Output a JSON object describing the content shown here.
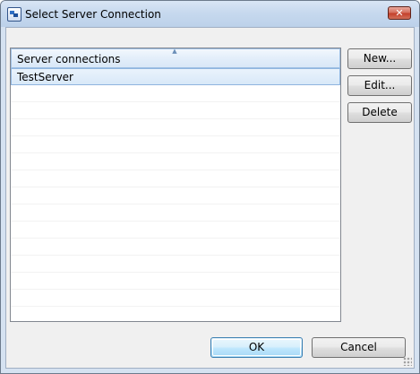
{
  "window": {
    "title": "Select Server Connection",
    "icon": "server-connection-app-icon",
    "close_icon": "close-icon"
  },
  "table": {
    "column_header": "Server connections",
    "sort_indicator": "ascending",
    "rows": [
      {
        "label": "TestServer",
        "selected": true
      }
    ]
  },
  "side_buttons": {
    "new_label": "New...",
    "edit_label": "Edit...",
    "delete_label": "Delete"
  },
  "footer_buttons": {
    "ok_label": "OK",
    "cancel_label": "Cancel"
  },
  "colors": {
    "titlebar": "#c7d9ee",
    "selection": "#d8e8f8",
    "close_button": "#c4402b",
    "default_button_border": "#3c7fb1"
  }
}
